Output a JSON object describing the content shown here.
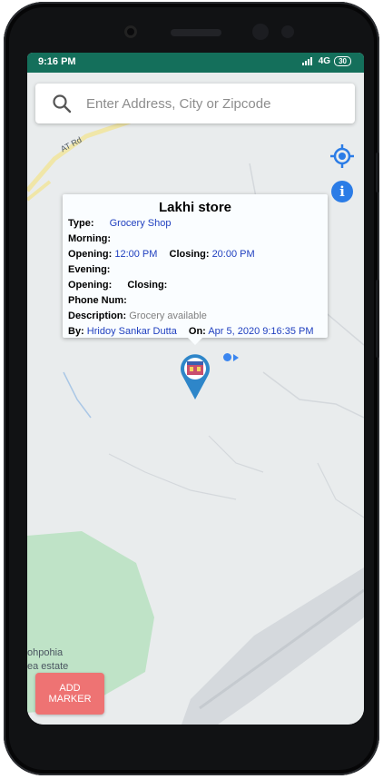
{
  "status_bar": {
    "time": "9:16 PM",
    "network": "4G",
    "battery": "30"
  },
  "search": {
    "placeholder": "Enter Address, City or Zipcode",
    "icon": "search-icon"
  },
  "map": {
    "road_label": "AT Rd",
    "area_label_line1": "ohpohia",
    "area_label_line2": "ea estate"
  },
  "controls": {
    "location_icon": "my-location-icon",
    "info_icon": "info-icon",
    "info_glyph": "i"
  },
  "info_window": {
    "title": "Lakhi store",
    "type_label": "Type:",
    "type_value": "Grocery Shop",
    "morning_label": "Morning:",
    "morning_opening_label": "Opening:",
    "morning_opening_value": "12:00 PM",
    "morning_closing_label": "Closing:",
    "morning_closing_value": "20:00 PM",
    "evening_label": "Evening:",
    "evening_opening_label": "Opening:",
    "evening_closing_label": "Closing:",
    "phone_label": "Phone Num:",
    "description_label": "Description:",
    "description_value": "Grocery available",
    "by_label": "By:",
    "by_value": "Hridoy Sankar Dutta",
    "on_label": "On:",
    "on_value": "Apr 5, 2020 9:16:35 PM"
  },
  "add_marker_button": {
    "label": "ADD MARKER"
  },
  "colors": {
    "status_bar": "#146f5b",
    "accent_blue": "#2b7ce6",
    "add_marker": "#ee7373",
    "link_value": "#1f3fbf"
  }
}
